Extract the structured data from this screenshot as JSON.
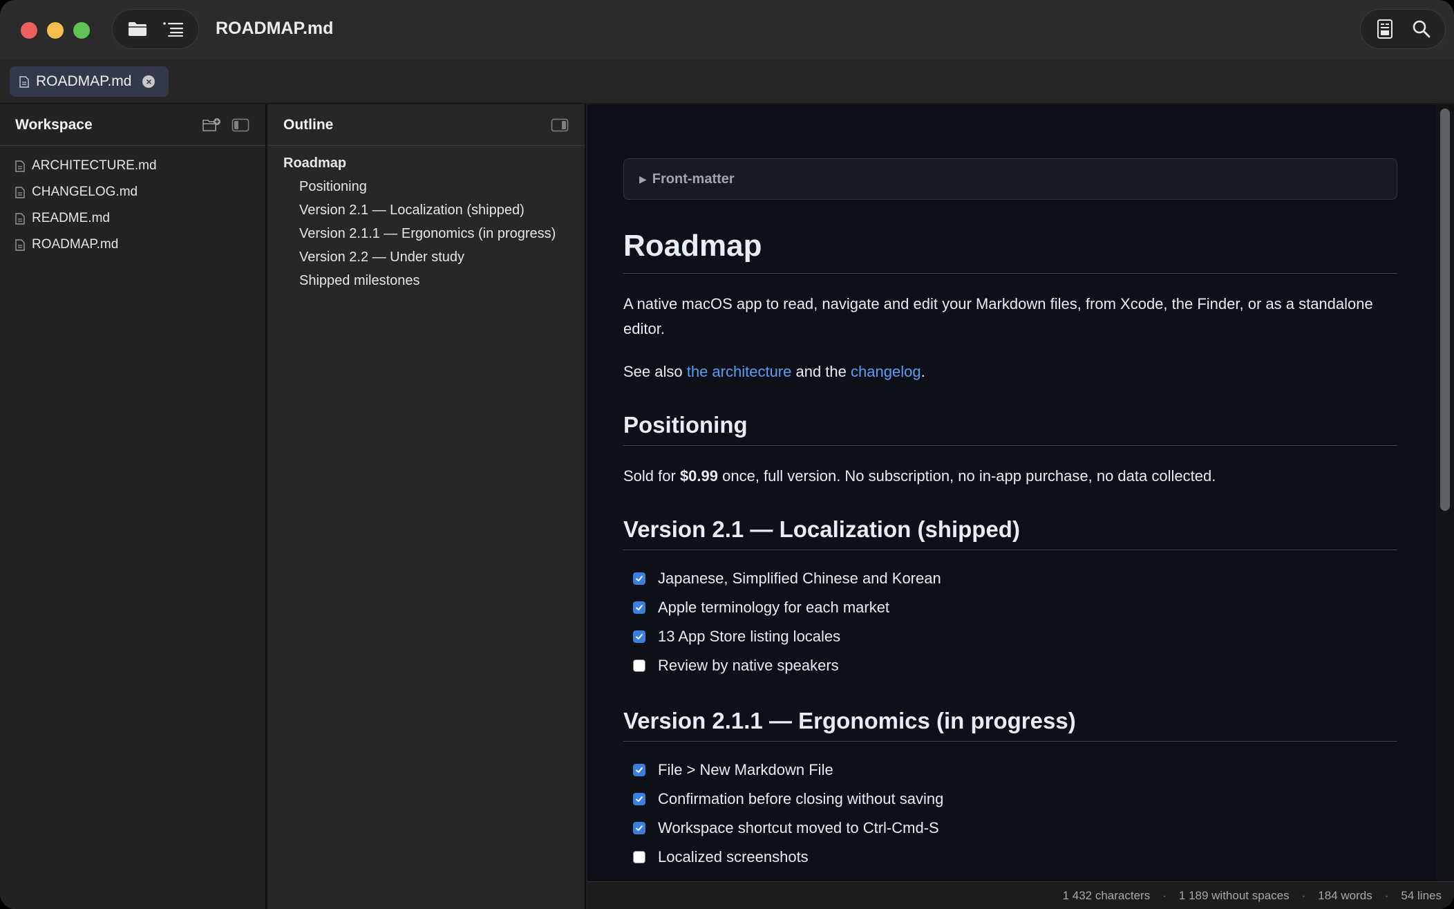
{
  "window": {
    "title": "ROADMAP.md"
  },
  "tabs": [
    {
      "label": "ROADMAP.md",
      "close": "×"
    }
  ],
  "workspace": {
    "title": "Workspace",
    "files": [
      "ARCHITECTURE.md",
      "CHANGELOG.md",
      "README.md",
      "ROADMAP.md"
    ]
  },
  "outline": {
    "title": "Outline",
    "items": [
      {
        "level": 1,
        "label": "Roadmap"
      },
      {
        "level": 2,
        "label": "Positioning"
      },
      {
        "level": 2,
        "label": "Version 2.1 — Localization (shipped)"
      },
      {
        "level": 2,
        "label": "Version 2.1.1 — Ergonomics (in progress)"
      },
      {
        "level": 2,
        "label": "Version 2.2 — Under study"
      },
      {
        "level": 2,
        "label": "Shipped milestones"
      }
    ]
  },
  "document": {
    "frontmatter": "Front-matter",
    "h1": "Roadmap",
    "intro": "A native macOS app to read, navigate and edit your Markdown files, from Xcode, the Finder, or as a standalone editor.",
    "see_also": {
      "prefix": "See also ",
      "link1": "the architecture",
      "middle": " and the ",
      "link2": "changelog",
      "suffix": "."
    },
    "positioning": {
      "heading": "Positioning",
      "prefix": "Sold for ",
      "price": "$0.99",
      "suffix": " once, full version. No subscription, no in-app purchase, no data collected."
    },
    "sections": [
      {
        "heading": "Version 2.1 — Localization (shipped)",
        "tasks": [
          {
            "label": "Japanese, Simplified Chinese and Korean",
            "checked": true
          },
          {
            "label": "Apple terminology for each market",
            "checked": true
          },
          {
            "label": "13 App Store listing locales",
            "checked": true
          },
          {
            "label": "Review by native speakers",
            "checked": false
          }
        ]
      },
      {
        "heading": "Version 2.1.1 — Ergonomics (in progress)",
        "tasks": [
          {
            "label": "File > New Markdown File",
            "checked": true
          },
          {
            "label": "Confirmation before closing without saving",
            "checked": true
          },
          {
            "label": "Workspace shortcut moved to Ctrl-Cmd-S",
            "checked": true
          },
          {
            "label": "Localized screenshots",
            "checked": false
          }
        ]
      }
    ]
  },
  "status": {
    "characters": "1 432 characters",
    "without_spaces": "1 189 without spaces",
    "words": "184 words",
    "lines": "54 lines",
    "separator": "·"
  },
  "colors": {
    "accent": "#3a7fe0",
    "link": "#5b9cf7",
    "background": "#0d1117"
  }
}
